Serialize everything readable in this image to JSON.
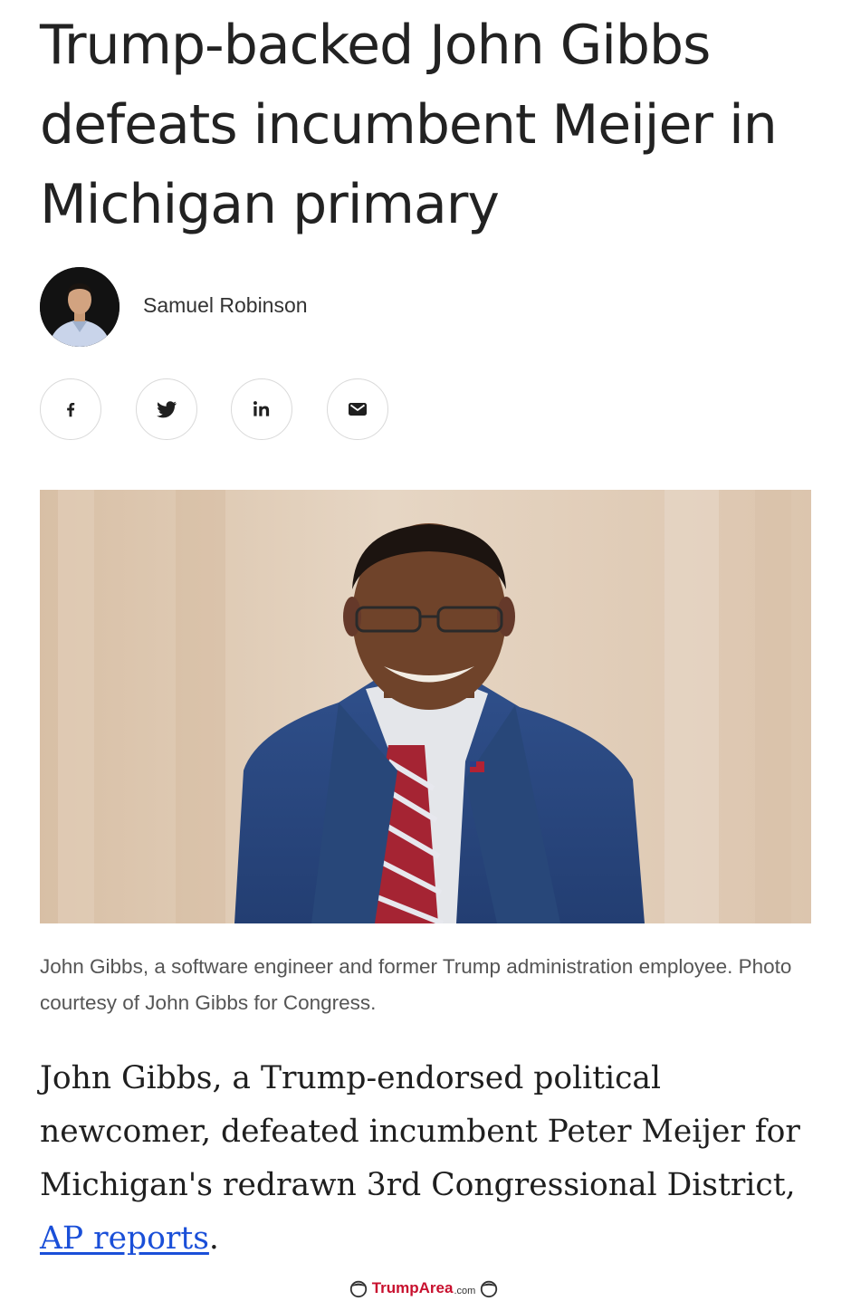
{
  "article": {
    "headline": "Trump-backed John Gibbs defeats incumbent Meijer in Michigan primary",
    "author": "Samuel Robinson",
    "caption": "John Gibbs, a software engineer and former Trump administration employee. Photo courtesy of John Gibbs for Congress.",
    "body_before_link": "John Gibbs, a Trump-endorsed political newcomer, defeated incumbent Peter Meijer for Michigan's redrawn 3rd Congressional District, ",
    "link_text": "AP reports",
    "body_after_link": "."
  },
  "share": [
    {
      "icon": "facebook-icon"
    },
    {
      "icon": "twitter-icon"
    },
    {
      "icon": "linkedin-icon"
    },
    {
      "icon": "email-icon"
    }
  ],
  "watermark": {
    "brand": "TrumpArea",
    "suffix": ".com"
  },
  "colors": {
    "link": "#1a4fd8",
    "watermark": "#c8102e",
    "share_border": "#d9d9d9"
  }
}
